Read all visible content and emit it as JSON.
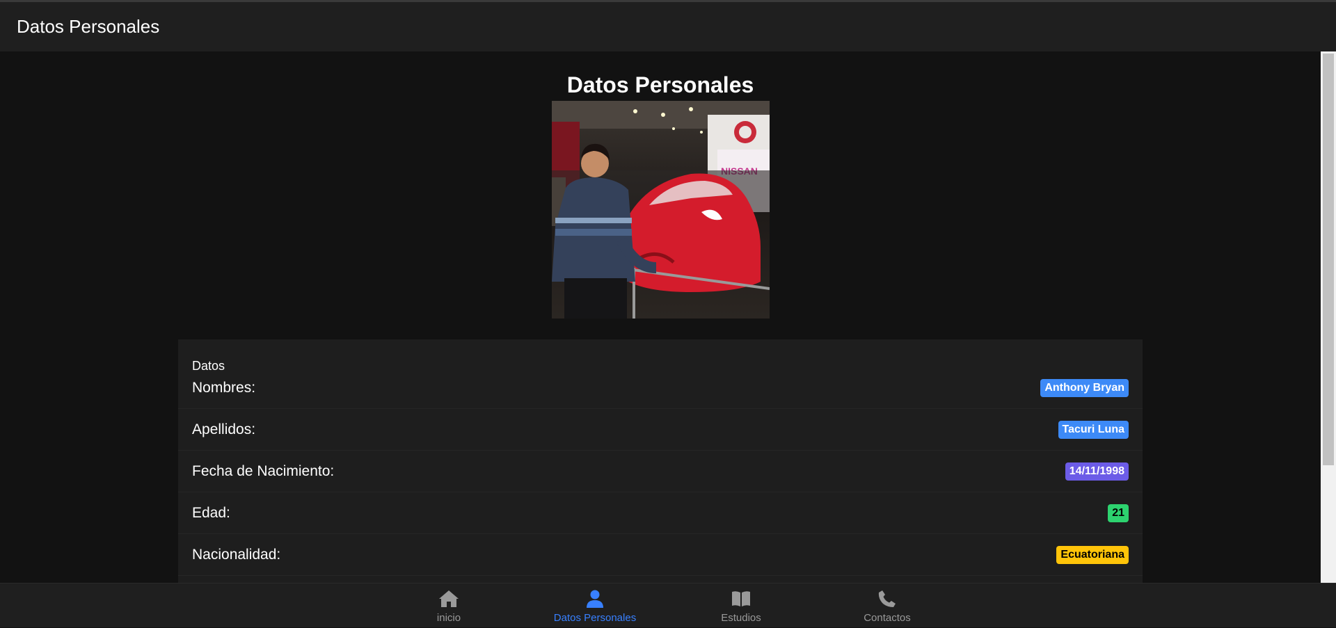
{
  "header": {
    "title": "Datos Personales"
  },
  "page": {
    "heading": "Datos Personales"
  },
  "card": {
    "title": "Datos",
    "rows": [
      {
        "label": "Nombres:",
        "value": "Anthony Bryan",
        "badge_color": "#3d8af7",
        "text_color": "#ffffff"
      },
      {
        "label": "Apellidos:",
        "value": "Tacuri Luna",
        "badge_color": "#3d8af7",
        "text_color": "#ffffff"
      },
      {
        "label": "Fecha de Nacimiento:",
        "value": "14/11/1998",
        "badge_color": "#6c5ce7",
        "text_color": "#ffffff"
      },
      {
        "label": "Edad:",
        "value": "21",
        "badge_color": "#2dd36f",
        "text_color": "#000000"
      },
      {
        "label": "Nacionalidad:",
        "value": "Ecuatoriana",
        "badge_color": "#ffc409",
        "text_color": "#000000"
      }
    ]
  },
  "photo": {
    "sign_text": "NISSAN"
  },
  "tabs": [
    {
      "label": "inicio",
      "icon": "home-icon",
      "active": false
    },
    {
      "label": "Datos Personales",
      "icon": "person-icon",
      "active": true
    },
    {
      "label": "Estudios",
      "icon": "book-icon",
      "active": false
    },
    {
      "label": "Contactos",
      "icon": "phone-icon",
      "active": false
    }
  ],
  "colors": {
    "accent": "#3880ff",
    "inactive": "#9a9a9a",
    "toolbar": "#1f1f1f",
    "background": "#121212"
  }
}
